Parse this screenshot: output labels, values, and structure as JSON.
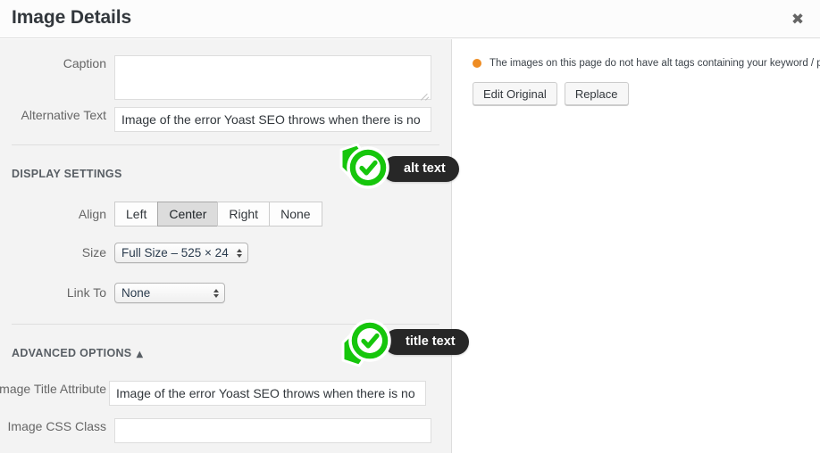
{
  "modal": {
    "title": "Image Details",
    "close_label": "✖"
  },
  "settings": {
    "fields": {
      "caption": {
        "label": "Caption",
        "value": "",
        "placeholder": ""
      },
      "alt_text": {
        "label": "Alternative Text",
        "value": "Image of the error Yoast SEO throws when there is no image w",
        "placeholder": ""
      },
      "title_attribute": {
        "label": "Image Title Attribute",
        "value": "Image of the error Yoast SEO throws when there is no image w",
        "placeholder": ""
      },
      "css_class": {
        "label": "Image CSS Class",
        "value": "",
        "placeholder": ""
      }
    },
    "display_settings": {
      "heading": "DISPLAY SETTINGS",
      "align": {
        "label": "Align",
        "options": [
          "Left",
          "Center",
          "Right",
          "None"
        ],
        "selected": "Center"
      },
      "size": {
        "label": "Size",
        "selected": "Full Size – 525 × 24"
      },
      "link_to": {
        "label": "Link To",
        "selected": "None"
      }
    },
    "advanced_options": {
      "heading": "ADVANCED OPTIONS",
      "toggle_icon": "▲"
    }
  },
  "seo_panel": {
    "note": "The images on this page do not have alt tags containing your keyword / phrase.",
    "bullet_color": "#ee8c23",
    "buttons": [
      {
        "label": "Edit Original"
      },
      {
        "label": "Replace"
      }
    ]
  },
  "callouts": [
    {
      "label": "alt text",
      "icon": "check-circle",
      "color": "#16c60c"
    },
    {
      "label": "title text",
      "icon": "check-circle",
      "color": "#16c60c"
    }
  ]
}
